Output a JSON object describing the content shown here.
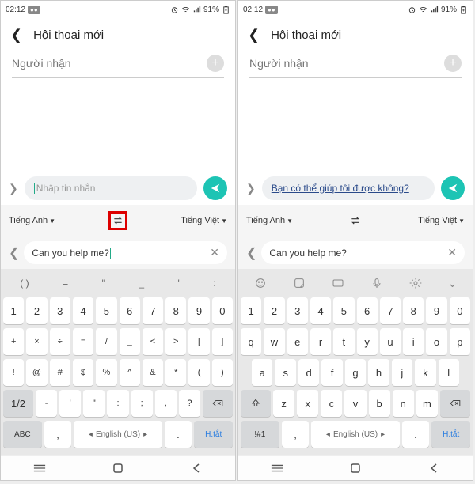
{
  "status": {
    "time": "02:12",
    "battery": "91%"
  },
  "header": {
    "title": "Hội thoại mới"
  },
  "recipient_placeholder": "Người nhận",
  "compose": {
    "placeholder": "Nhập tin nhắn",
    "translated": "Bạn có thể giúp tôi được không?"
  },
  "translate": {
    "source": "Tiếng Anh",
    "target": "Tiếng Việt",
    "input": "Can you help me?"
  },
  "keys": {
    "left_suggest": [
      "( )",
      "=",
      "\"",
      "_",
      "'",
      ":"
    ],
    "left_r1": [
      "1",
      "2",
      "3",
      "4",
      "5",
      "6",
      "7",
      "8",
      "9",
      "0"
    ],
    "left_r2": [
      "+",
      "×",
      "÷",
      "=",
      "/",
      "_",
      "<",
      ">",
      "[",
      "]"
    ],
    "left_r3": [
      "!",
      "@",
      "#",
      "$",
      "%",
      "^",
      "&",
      "*",
      "(",
      ")"
    ],
    "left_r4_mid": [
      "-",
      "'",
      "\"",
      ":",
      ";",
      ",",
      "?"
    ],
    "left_mode": "1/2",
    "left_abc": "ABC",
    "right_r1": [
      "1",
      "2",
      "3",
      "4",
      "5",
      "6",
      "7",
      "8",
      "9",
      "0"
    ],
    "right_r2": [
      "q",
      "w",
      "e",
      "r",
      "t",
      "y",
      "u",
      "i",
      "o",
      "p"
    ],
    "right_r3": [
      "a",
      "s",
      "d",
      "f",
      "g",
      "h",
      "j",
      "k",
      "l"
    ],
    "right_r4_mid": [
      "z",
      "x",
      "c",
      "v",
      "b",
      "n",
      "m"
    ],
    "right_mode": "!#1",
    "space_label": "English (US)",
    "shortcut": "H.tắt",
    "period": ".",
    "comma": ","
  }
}
